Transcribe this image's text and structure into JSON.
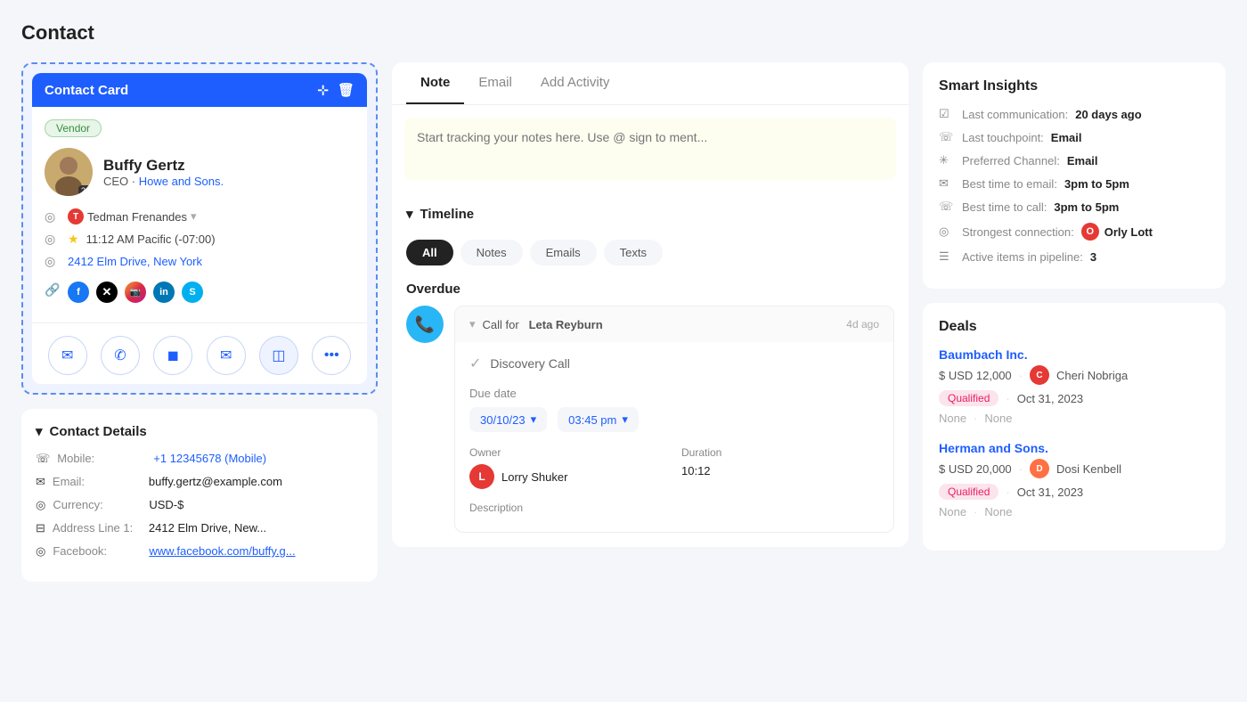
{
  "page": {
    "title": "Contact"
  },
  "contact_card": {
    "header_label": "Contact Card",
    "vendor_badge": "Vendor",
    "name": "Buffy Gertz",
    "title": "CEO",
    "company": "Howe and Sons.",
    "assigned_to": "Tedman Frenandes",
    "time": "11:12 AM Pacific (-07:00)",
    "address": "2412 Elm Drive, New York",
    "avatar_badge": "22",
    "action_buttons": [
      {
        "label": "✉",
        "name": "email-btn"
      },
      {
        "label": "✆",
        "name": "phone-btn"
      },
      {
        "label": "◼",
        "name": "contact-btn"
      },
      {
        "label": "✉",
        "name": "message-btn"
      },
      {
        "label": "◫",
        "name": "calendar-btn"
      },
      {
        "label": "•••",
        "name": "more-btn"
      }
    ]
  },
  "contact_details": {
    "section_label": "Contact Details",
    "fields": [
      {
        "label": "Mobile:",
        "value": "+1 12345678 (Mobile)",
        "is_link": false,
        "is_blue": true
      },
      {
        "label": "Email:",
        "value": "buffy.gertz@example.com",
        "is_link": false
      },
      {
        "label": "Currency:",
        "value": "USD-$",
        "is_link": false
      },
      {
        "label": "Address Line 1:",
        "value": "2412 Elm Drive, New...",
        "is_link": false
      },
      {
        "label": "Facebook:",
        "value": "www.facebook.com/buffy.g...",
        "is_link": true
      }
    ]
  },
  "note_tab": {
    "tabs": [
      {
        "label": "Note",
        "active": true
      },
      {
        "label": "Email",
        "active": false
      },
      {
        "label": "Add Activity",
        "active": false
      }
    ],
    "placeholder": "Start tracking your notes here. Use @ sign to ment..."
  },
  "timeline": {
    "header": "Timeline",
    "filter_tabs": [
      {
        "label": "All",
        "active": true
      },
      {
        "label": "Notes",
        "active": false
      },
      {
        "label": "Emails",
        "active": false
      },
      {
        "label": "Texts",
        "active": false
      }
    ],
    "overdue_label": "Overdue",
    "call_item": {
      "title": "Call for",
      "person": "Leta Reyburn",
      "time_ago": "4d ago",
      "sub_title": "Discovery Call",
      "due_date_label": "Due date",
      "date": "30/10/23",
      "time": "03:45 pm",
      "owner_label": "Owner",
      "owner_name": "Lorry Shuker",
      "owner_initial": "L",
      "duration_label": "Duration",
      "duration": "10:12",
      "desc_label": "Description"
    }
  },
  "smart_insights": {
    "title": "Smart Insights",
    "rows": [
      {
        "icon": "☑",
        "label": "Last communication:",
        "value": "20 days ago"
      },
      {
        "icon": "☏",
        "label": "Last touchpoint:",
        "value": "Email"
      },
      {
        "icon": "✳",
        "label": "Preferred Channel:",
        "value": "Email"
      },
      {
        "icon": "✉",
        "label": "Best time to email:",
        "value": "3pm to 5pm"
      },
      {
        "icon": "☏",
        "label": "Best time to call:",
        "value": "3pm to 5pm"
      },
      {
        "icon": "◎",
        "label": "Strongest connection:",
        "value": "Orly Lott"
      },
      {
        "icon": "☰",
        "label": "Active items in pipeline:",
        "value": "3"
      }
    ],
    "connection_avatar_initial": "O",
    "connection_avatar_color": "#e53935"
  },
  "deals": {
    "title": "Deals",
    "items": [
      {
        "name": "Baumbach Inc.",
        "amount": "$ USD 12,000",
        "owner": "Cheri Nobriga",
        "owner_initial": "C",
        "owner_avatar_color": "#e53935",
        "status": "Qualified",
        "date": "Oct 31, 2023",
        "none1": "None",
        "none2": "None"
      },
      {
        "name": "Herman and Sons.",
        "amount": "$ USD 20,000",
        "owner": "Dosi Kenbell",
        "owner_initial": "D",
        "owner_avatar_color": "#ff7043",
        "status": "Qualified",
        "date": "Oct 31, 2023",
        "none1": "None",
        "none2": "None"
      }
    ]
  }
}
